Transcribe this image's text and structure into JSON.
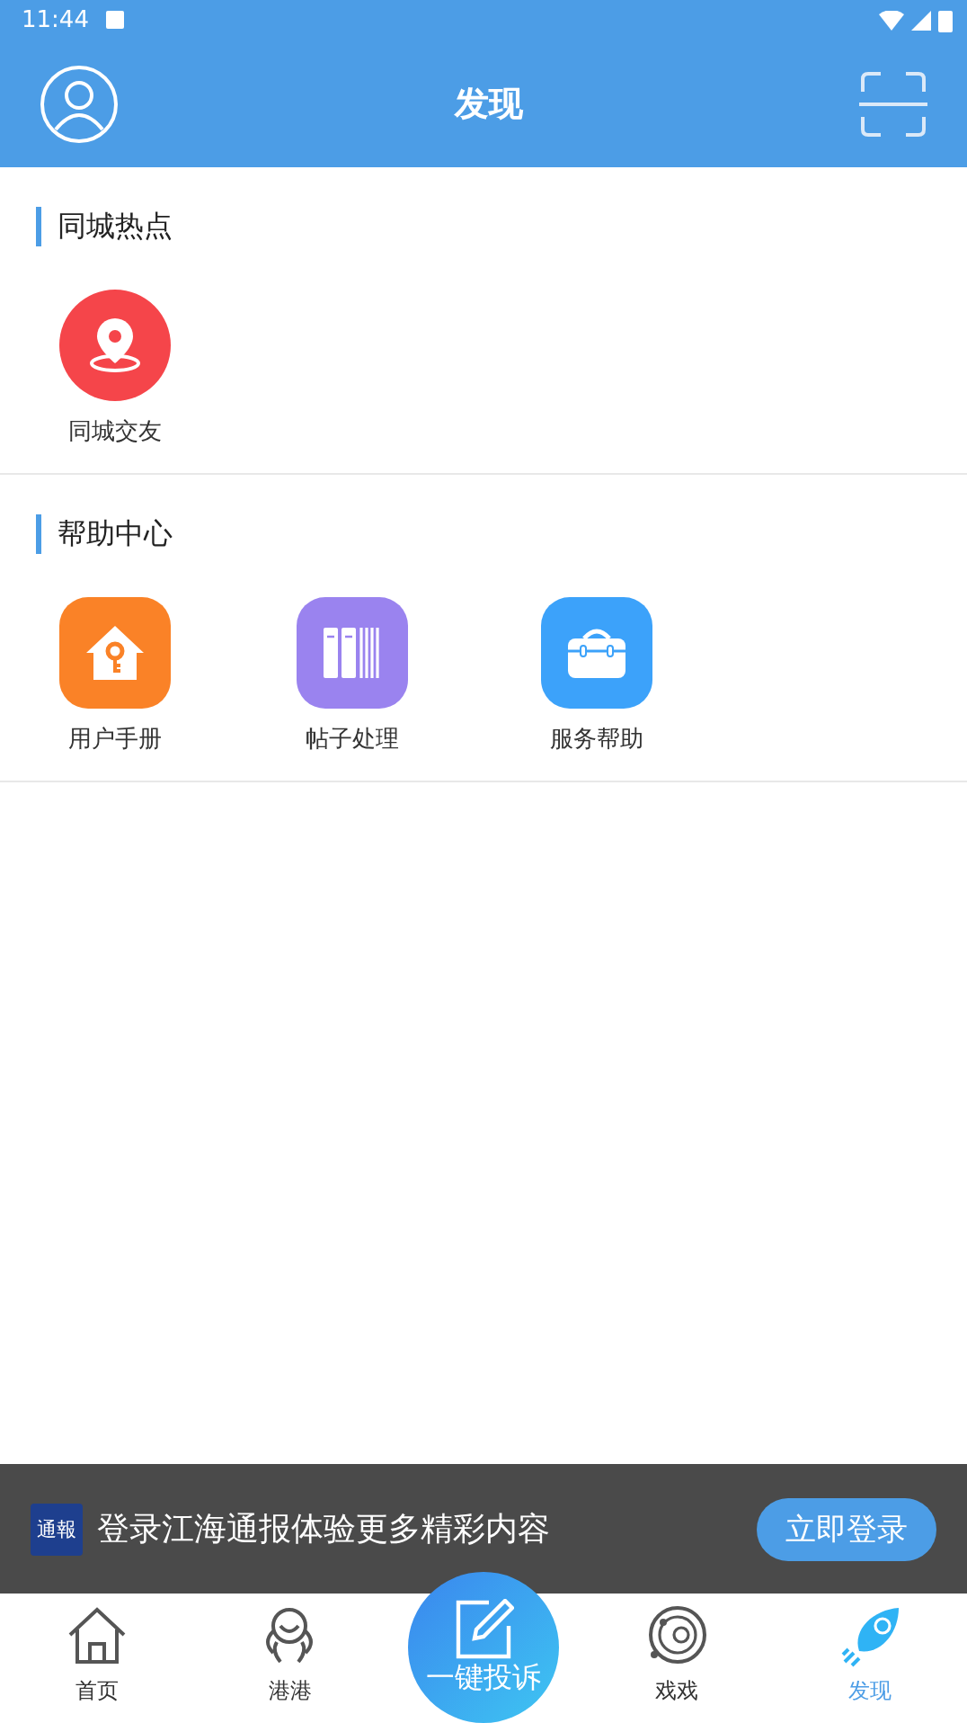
{
  "status_bar": {
    "time": "11:44"
  },
  "header": {
    "title": "发现"
  },
  "sections": [
    {
      "title": "同城热点",
      "items": [
        {
          "label": "同城交友",
          "kind": "pin",
          "color": "#f5454a"
        }
      ]
    },
    {
      "title": "帮助中心",
      "items": [
        {
          "label": "用户手册",
          "kind": "house",
          "color": "#fa8227"
        },
        {
          "label": "帖子处理",
          "kind": "books",
          "color": "#9a83ef"
        },
        {
          "label": "服务帮助",
          "kind": "bag",
          "color": "#3ca2fa"
        }
      ]
    }
  ],
  "login_banner": {
    "logo_text": "通報",
    "message": "登录江海通报体验更多精彩内容",
    "button": "立即登录"
  },
  "bottom_nav": [
    {
      "label": "首页",
      "kind": "home",
      "selected": false
    },
    {
      "label": "港港",
      "kind": "mascot",
      "selected": false
    },
    {
      "label": "一键投诉",
      "kind": "center",
      "selected": false
    },
    {
      "label": "戏戏",
      "kind": "orbit",
      "selected": false
    },
    {
      "label": "发现",
      "kind": "rocket",
      "selected": true
    }
  ]
}
